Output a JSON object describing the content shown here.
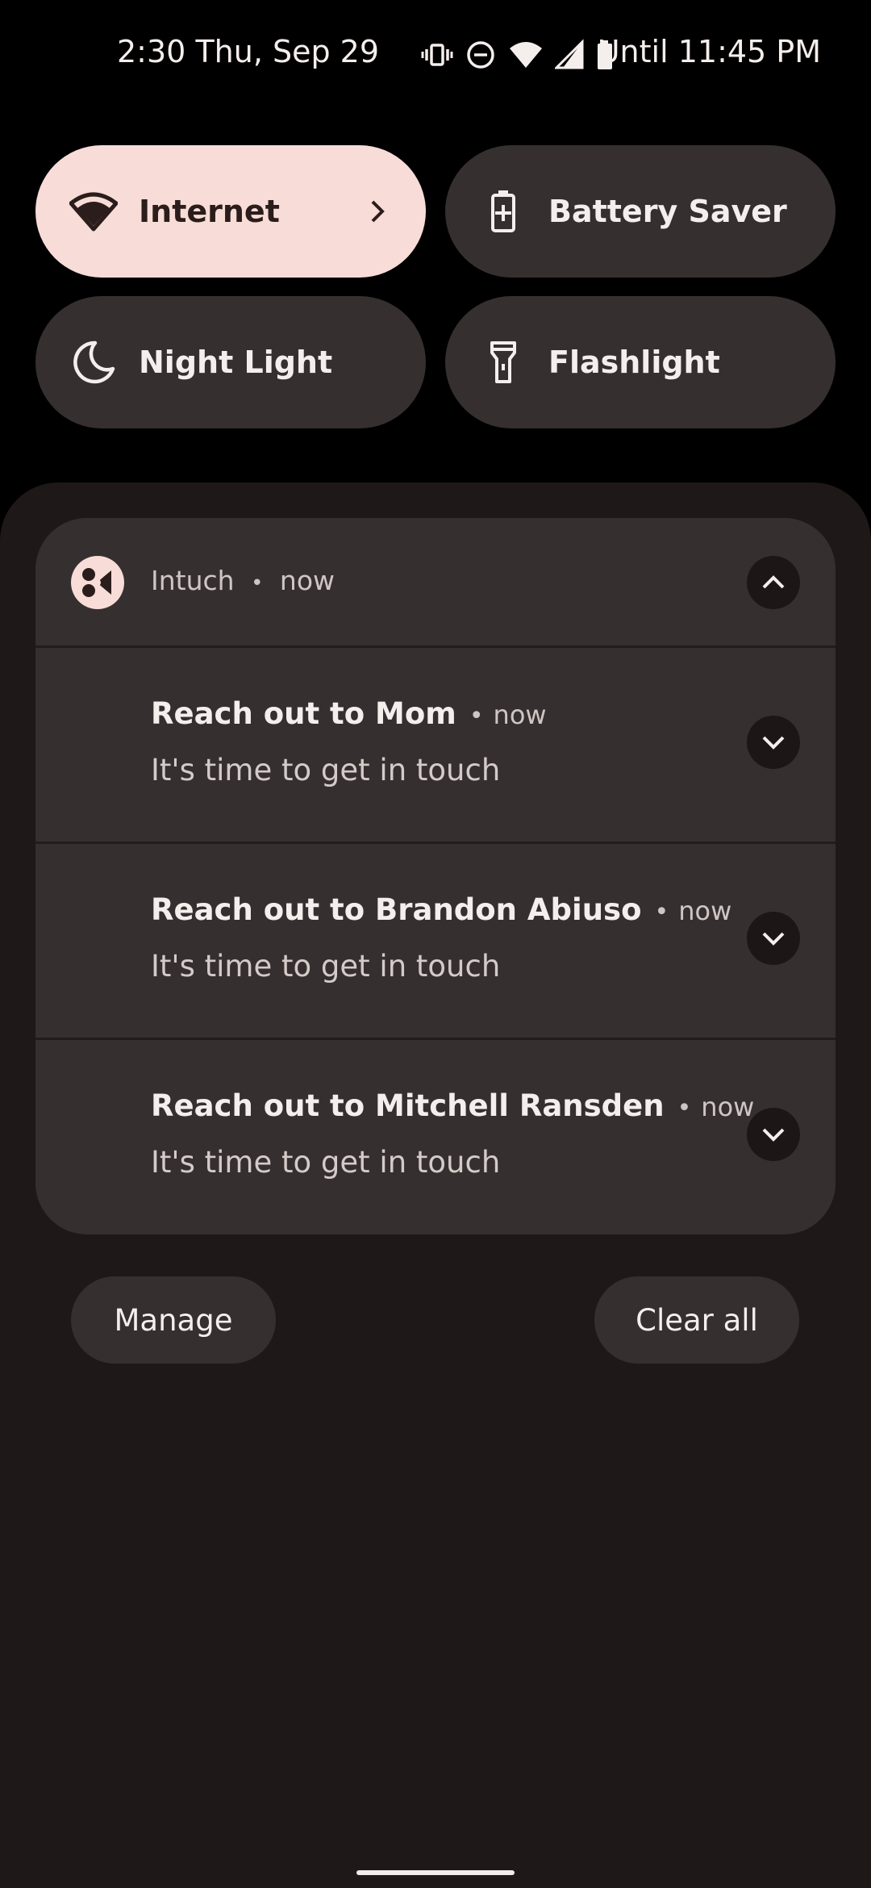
{
  "status_bar": {
    "time": "2:30",
    "date": "Thu, Sep 29",
    "alarm_text": "Until 11:45 PM",
    "icons": [
      "vibrate-icon",
      "do-not-disturb-icon",
      "wifi-icon",
      "cell-signal-icon",
      "battery-icon"
    ]
  },
  "quick_settings": {
    "tiles": [
      {
        "label": "Internet",
        "icon": "wifi-icon",
        "active": true,
        "has_chevron": true
      },
      {
        "label": "Battery Saver",
        "icon": "battery-saver-icon",
        "active": false
      },
      {
        "label": "Night Light",
        "icon": "moon-icon",
        "active": false
      },
      {
        "label": "Flashlight",
        "icon": "flashlight-icon",
        "active": false
      }
    ]
  },
  "notification_group": {
    "app_name": "Intuch",
    "separator": "•",
    "time": "now",
    "expanded": true,
    "items": [
      {
        "title": "Reach out to Mom",
        "time": "now",
        "body": "It's time to get in touch"
      },
      {
        "title": "Reach out to Brandon Abiuso",
        "time": "now",
        "body": "It's time to get in touch"
      },
      {
        "title": "Reach out to Mitchell Ransden",
        "time": "now",
        "body": "It's time to get in touch"
      }
    ]
  },
  "actions": {
    "manage_label": "Manage",
    "clear_all_label": "Clear all"
  },
  "colors": {
    "accent_tile": "#f8dcd7",
    "tile_bg": "#35302f",
    "shade_bg": "#1e1918",
    "text_primary": "#f4eeec",
    "text_secondary": "#cfc6c4"
  }
}
